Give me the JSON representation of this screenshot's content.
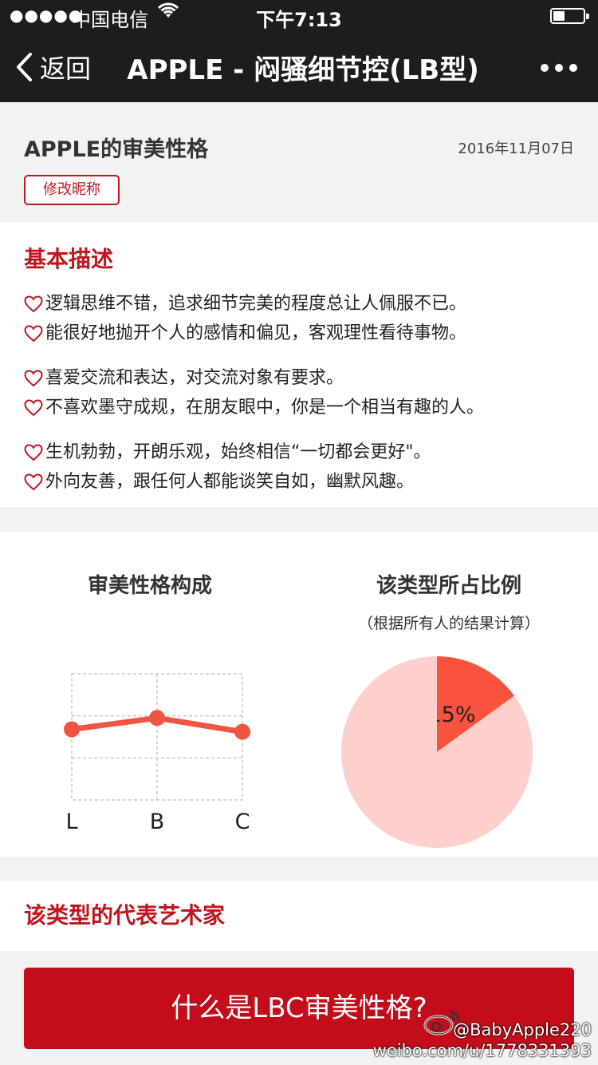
{
  "status_bar": {
    "signal": "●●●●●",
    "carrier": "中国电信",
    "time": "下午7:13",
    "battery_level": 0.4
  },
  "nav": {
    "back_label": "返回",
    "title": "APPLE - 闷骚细节控(LB型)"
  },
  "header": {
    "title": "APPLE的审美性格",
    "date": "2016年11月07日",
    "edit_button": "修改昵称"
  },
  "description": {
    "section_title": "基本描述",
    "lines": [
      "逻辑思维不错，追求细节完美的程度总让人佩服不已。",
      "能很好地抛开个人的感情和偏见，客观理性看待事物。",
      "喜爱交流和表达，对交流对象有要求。",
      "不喜欢墨守成规，在朋友眼中，你是一个相当有趣的人。",
      "生机勃勃，开朗乐观，始终相信“一切都会更好\"。",
      "外向友善，跟任何人都能谈笑自如，幽默风趣。"
    ]
  },
  "charts_section": {
    "left_title": "审美性格构成",
    "right_title": "该类型所占比例",
    "right_subtitle": "（根据所有人的结果计算）"
  },
  "chart_data": [
    {
      "type": "line",
      "title": "审美性格构成",
      "categories": [
        "L",
        "B",
        "C"
      ],
      "values": [
        0.56,
        0.65,
        0.54
      ],
      "ylim": [
        0,
        1
      ],
      "grid": true,
      "color": "#f05543"
    },
    {
      "type": "pie",
      "title": "该类型所占比例",
      "slices": [
        {
          "label": "15%",
          "value": 15,
          "color": "#f9523f"
        },
        {
          "label": "",
          "value": 85,
          "color": "#fdd0cb"
        }
      ]
    }
  ],
  "artist_section": {
    "title": "该类型的代表艺术家"
  },
  "cta_button": "什么是LBC审美性格?",
  "watermark": {
    "handle": "@BabyApple220",
    "url": "weibo.com/u/1778331393"
  },
  "colors": {
    "accent": "#c0151e",
    "nav_bg": "#1d1d1f",
    "line": "#f05543",
    "pie_main": "#f9523f",
    "pie_rest": "#fdd0cb"
  }
}
